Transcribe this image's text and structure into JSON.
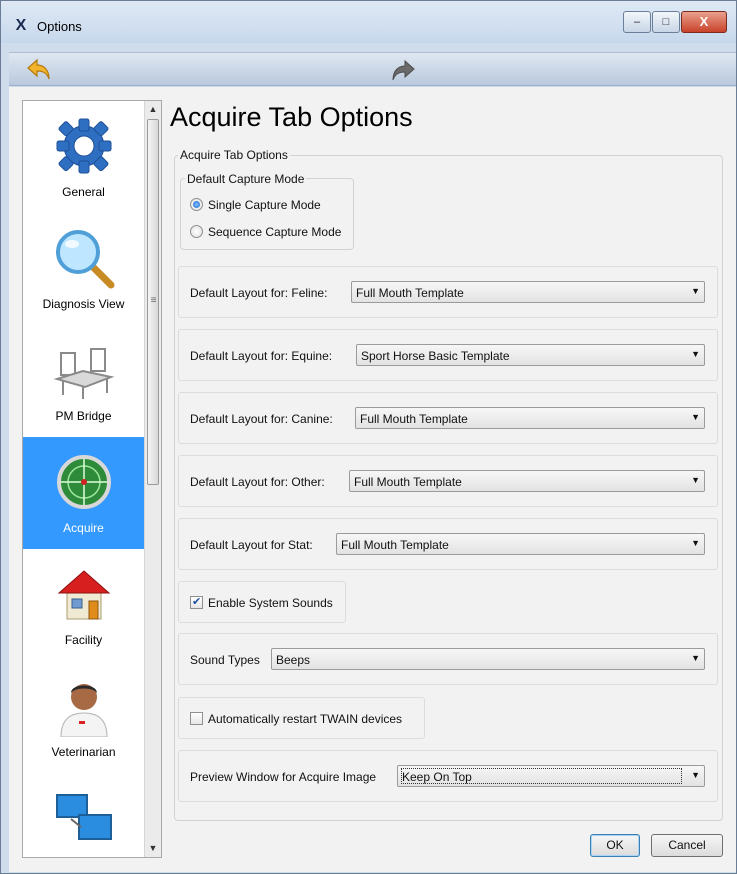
{
  "window": {
    "title": "Options",
    "app_icon_glyph": "X",
    "controls": {
      "minimize": "‒",
      "maximize": "□",
      "close": "X"
    }
  },
  "toolbar": {
    "back_icon": "back-arrow-icon",
    "forward_icon": "forward-arrow-icon",
    "back_color": "#f0b428",
    "forward_color": "#6b6b6b"
  },
  "sidebar": {
    "items": [
      {
        "label": "General",
        "icon": "gear-icon",
        "selected": false
      },
      {
        "label": "Diagnosis View",
        "icon": "magnifier-icon",
        "selected": false
      },
      {
        "label": "PM Bridge",
        "icon": "bridge-chairs-icon",
        "selected": false
      },
      {
        "label": "Acquire",
        "icon": "crosshair-scope-icon",
        "selected": true
      },
      {
        "label": "Facility",
        "icon": "house-icon",
        "selected": false
      },
      {
        "label": "Veterinarian",
        "icon": "veterinarian-person-icon",
        "selected": false
      },
      {
        "label": "",
        "icon": "network-monitors-icon",
        "selected": false
      }
    ],
    "selected_color": "#3399ff"
  },
  "main": {
    "page_title": "Acquire Tab Options",
    "group_title": "Acquire Tab Options",
    "capture_mode": {
      "title": "Default Capture Mode",
      "options": [
        {
          "label": "Single Capture Mode",
          "checked": true
        },
        {
          "label": "Sequence Capture Mode",
          "checked": false
        }
      ]
    },
    "layouts": [
      {
        "label": "Default Layout for: Feline:",
        "value": "Full Mouth Template"
      },
      {
        "label": "Default Layout for: Equine:",
        "value": "Sport Horse Basic Template"
      },
      {
        "label": "Default Layout for: Canine:",
        "value": "Full Mouth Template"
      },
      {
        "label": "Default Layout for: Other:",
        "value": "Full Mouth Template"
      },
      {
        "label": "Default Layout for Stat:",
        "value": "Full Mouth Template"
      }
    ],
    "enable_sounds": {
      "label": "Enable System Sounds",
      "checked": true
    },
    "sound_types": {
      "label": "Sound Types",
      "value": "Beeps"
    },
    "restart_twain": {
      "label": "Automatically restart TWAIN devices",
      "checked": false
    },
    "preview_window": {
      "label": "Preview Window for Acquire Image",
      "value": "Keep On Top"
    }
  },
  "buttons": {
    "ok": "OK",
    "cancel": "Cancel"
  }
}
